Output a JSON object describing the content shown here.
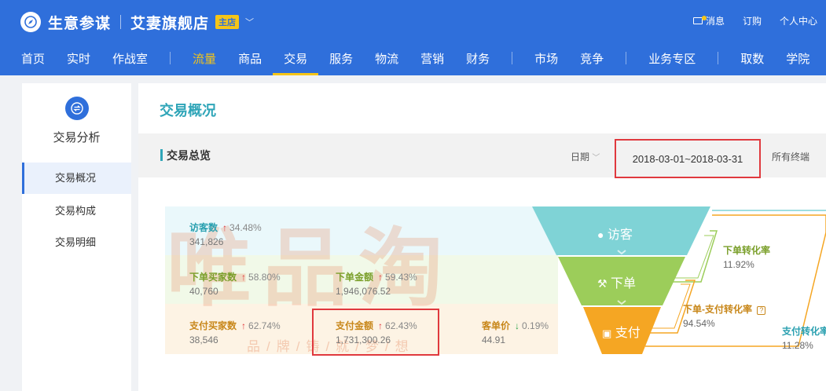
{
  "header": {
    "brand": "生意参谋",
    "shop_name": "艾妻旗舰店",
    "shop_badge": "主店",
    "top_links": [
      "消息",
      "订购",
      "个人中心"
    ]
  },
  "nav": {
    "items": [
      "首页",
      "实时",
      "作战室",
      "流量",
      "商品",
      "交易",
      "服务",
      "物流",
      "营销",
      "财务",
      "市场",
      "竞争",
      "业务专区",
      "取数",
      "学院"
    ],
    "active": "交易"
  },
  "sidebar": {
    "icon": "exchange-icon",
    "title": "交易分析",
    "items": [
      "交易概况",
      "交易构成",
      "交易明细"
    ],
    "active": "交易概况"
  },
  "main": {
    "title": "交易概况",
    "section_title": "交易总览",
    "date_label": "日期",
    "date_range": "2018-03-01~2018-03-31",
    "terminal_label": "所有终端"
  },
  "metrics": {
    "visitors": {
      "label": "访客数",
      "pct": "34.48%",
      "value": "341,826",
      "trend": "up"
    },
    "order_buyers": {
      "label": "下单买家数",
      "pct": "58.80%",
      "value": "40,760",
      "trend": "up"
    },
    "order_amount": {
      "label": "下单金额",
      "pct": "59.43%",
      "value": "1,946,076.52",
      "trend": "up"
    },
    "pay_buyers": {
      "label": "支付买家数",
      "pct": "62.74%",
      "value": "38,546",
      "trend": "up"
    },
    "pay_amount": {
      "label": "支付金额",
      "pct": "62.43%",
      "value": "1,731,300.26",
      "trend": "up"
    },
    "unit_price": {
      "label": "客单价",
      "pct": "0.19%",
      "value": "44.91",
      "trend": "down"
    }
  },
  "funnel": {
    "stages": [
      "访客",
      "下单",
      "支付"
    ],
    "colors": {
      "visit": "#7fd3d6",
      "order": "#9ccd5a",
      "pay": "#f5a623"
    }
  },
  "rates": {
    "order_conv": {
      "label": "下单转化率",
      "value": "11.92%"
    },
    "order_pay_conv": {
      "label": "下单-支付转化率",
      "value": "94.54%"
    },
    "pay_conv": {
      "label": "支付转化率",
      "value": "11.28%"
    }
  },
  "watermark": {
    "main": "唯品淘",
    "sub": "品/牌/铸/就/梦/想"
  },
  "colors": {
    "header_bg": "#2f6fdb",
    "accent_yellow": "#f5c518",
    "teal": "#2fa5b8",
    "highlight_red": "#e0393e"
  }
}
